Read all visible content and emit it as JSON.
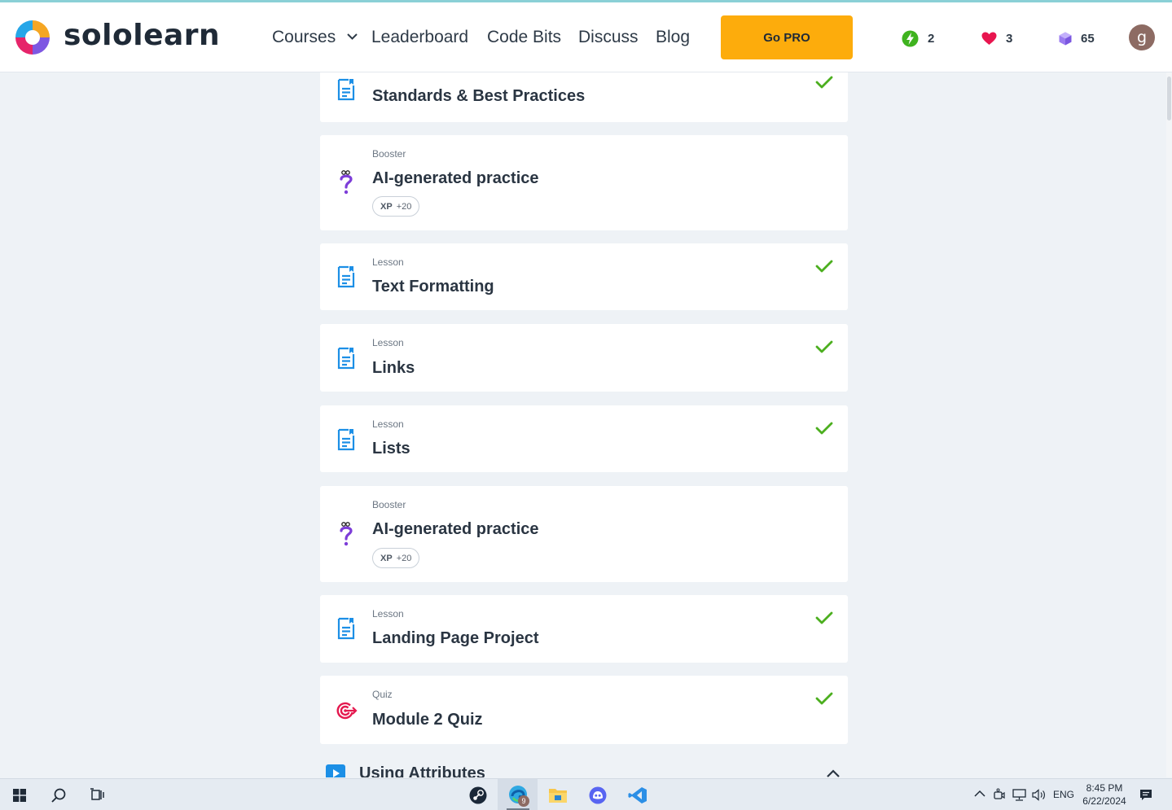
{
  "header": {
    "logo_text": "sololearn",
    "nav": [
      {
        "label": "Courses",
        "has_dropdown": true
      },
      {
        "label": "Leaderboard"
      },
      {
        "label": "Code Bits"
      },
      {
        "label": "Discuss"
      },
      {
        "label": "Blog"
      }
    ],
    "go_pro_label": "Go PRO",
    "stats": {
      "streak": "2",
      "hearts": "3",
      "gems": "65"
    },
    "avatar_letter": "g"
  },
  "items": [
    {
      "type": "Lesson",
      "title": "Standards & Best Practices",
      "icon": "lesson-icon",
      "completed": true
    },
    {
      "type": "Booster",
      "title": "AI-generated practice",
      "icon": "question-icon",
      "completed": false,
      "xp_label": "XP",
      "xp_value": "+20"
    },
    {
      "type": "Lesson",
      "title": "Text Formatting",
      "icon": "lesson-icon",
      "completed": true
    },
    {
      "type": "Lesson",
      "title": "Links",
      "icon": "lesson-icon",
      "completed": true
    },
    {
      "type": "Lesson",
      "title": "Lists",
      "icon": "lesson-icon",
      "completed": true
    },
    {
      "type": "Booster",
      "title": "AI-generated practice",
      "icon": "question-icon",
      "completed": false,
      "xp_label": "XP",
      "xp_value": "+20"
    },
    {
      "type": "Lesson",
      "title": "Landing Page Project",
      "icon": "lesson-icon",
      "completed": true
    },
    {
      "type": "Quiz",
      "title": "Module 2 Quiz",
      "icon": "target-icon",
      "completed": true
    }
  ],
  "next_section": {
    "title": "Using Attributes",
    "expanded": true
  },
  "taskbar": {
    "apps": [
      "windows-start",
      "search",
      "task-view",
      "steam",
      "edge",
      "file-explorer",
      "discord",
      "visual-studio"
    ],
    "edge_badge": "9",
    "language": "ENG",
    "time": "8:45 PM",
    "date": "6/22/2024"
  },
  "colors": {
    "accent_orange": "#fdac0c",
    "lesson_blue": "#1c8fe6",
    "check_green": "#4caf1f",
    "booster_purple": "#7d3dd8",
    "quiz_red": "#e4194f"
  }
}
